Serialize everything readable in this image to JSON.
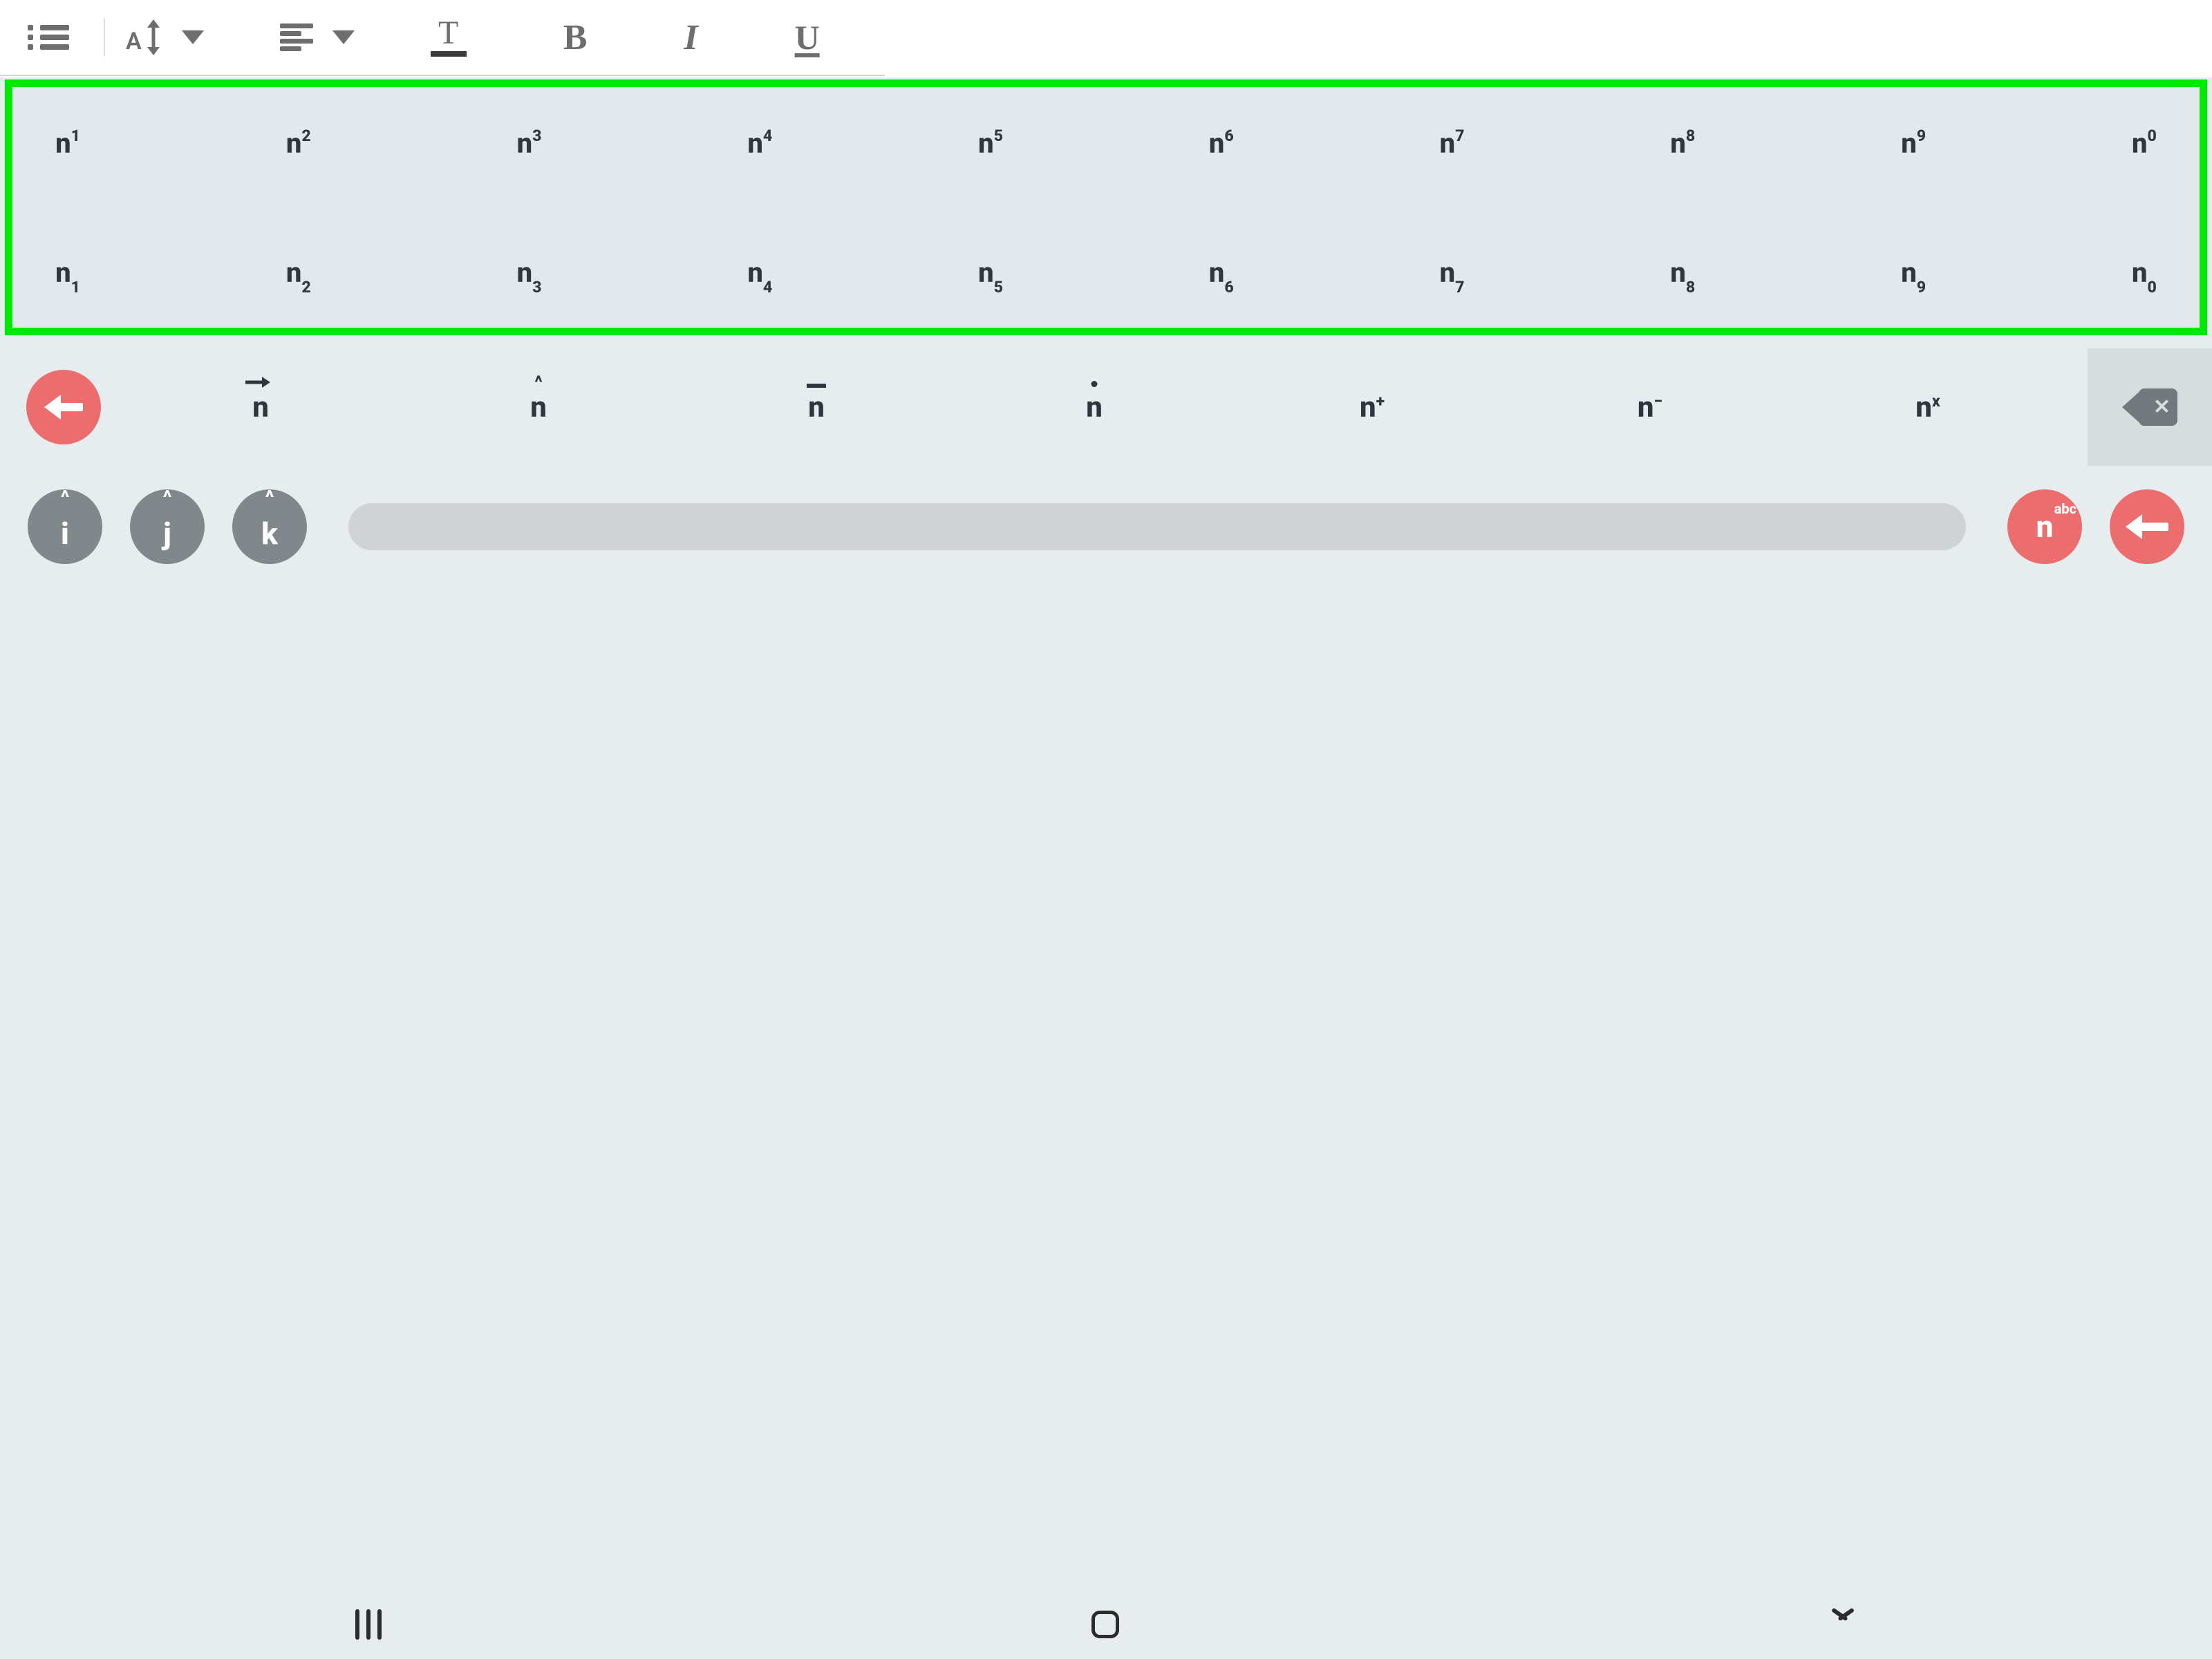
{
  "toolbar": {
    "list_button": "bulleted-list",
    "font_size": "A",
    "align": "align-left",
    "text_color_letter": "T",
    "bold": "B",
    "italic": "I",
    "underline": "U"
  },
  "superscript_row": {
    "base": "n",
    "exponents": [
      "1",
      "2",
      "3",
      "4",
      "5",
      "6",
      "7",
      "8",
      "9",
      "0"
    ]
  },
  "subscript_row": {
    "base": "n",
    "indices": [
      "1",
      "2",
      "3",
      "4",
      "5",
      "6",
      "7",
      "8",
      "9",
      "0"
    ]
  },
  "accent_row": {
    "base": "n",
    "keys": [
      {
        "id": "n-vector",
        "mark": "vec"
      },
      {
        "id": "n-hat",
        "mark": "hat",
        "mark_char": "^"
      },
      {
        "id": "n-bar",
        "mark": "bar"
      },
      {
        "id": "n-dot",
        "mark": "dot"
      },
      {
        "id": "n-plus",
        "sup": "+"
      },
      {
        "id": "n-minus",
        "sup": "−"
      },
      {
        "id": "n-x",
        "sup": "x"
      }
    ]
  },
  "unit_row": {
    "keys": [
      {
        "id": "i-hat",
        "letter": "i",
        "mark_char": "^"
      },
      {
        "id": "j-hat",
        "letter": "j",
        "mark_char": "^"
      },
      {
        "id": "k-hat",
        "letter": "k",
        "mark_char": "^"
      }
    ],
    "mode_toggle": {
      "n": "n",
      "abc": "abc"
    }
  },
  "icons": {
    "back": "arrow-left",
    "backspace": "backspace",
    "enter": "enter",
    "space": "space"
  },
  "nav": {
    "recents": "recents",
    "home": "home",
    "back": "chevron-down"
  },
  "colors": {
    "highlight": "#00e800",
    "accent": "#eb6d6d",
    "key_text": "#2e373d",
    "keyboard_bg": "#e7ecef",
    "muted": "#80888c"
  }
}
